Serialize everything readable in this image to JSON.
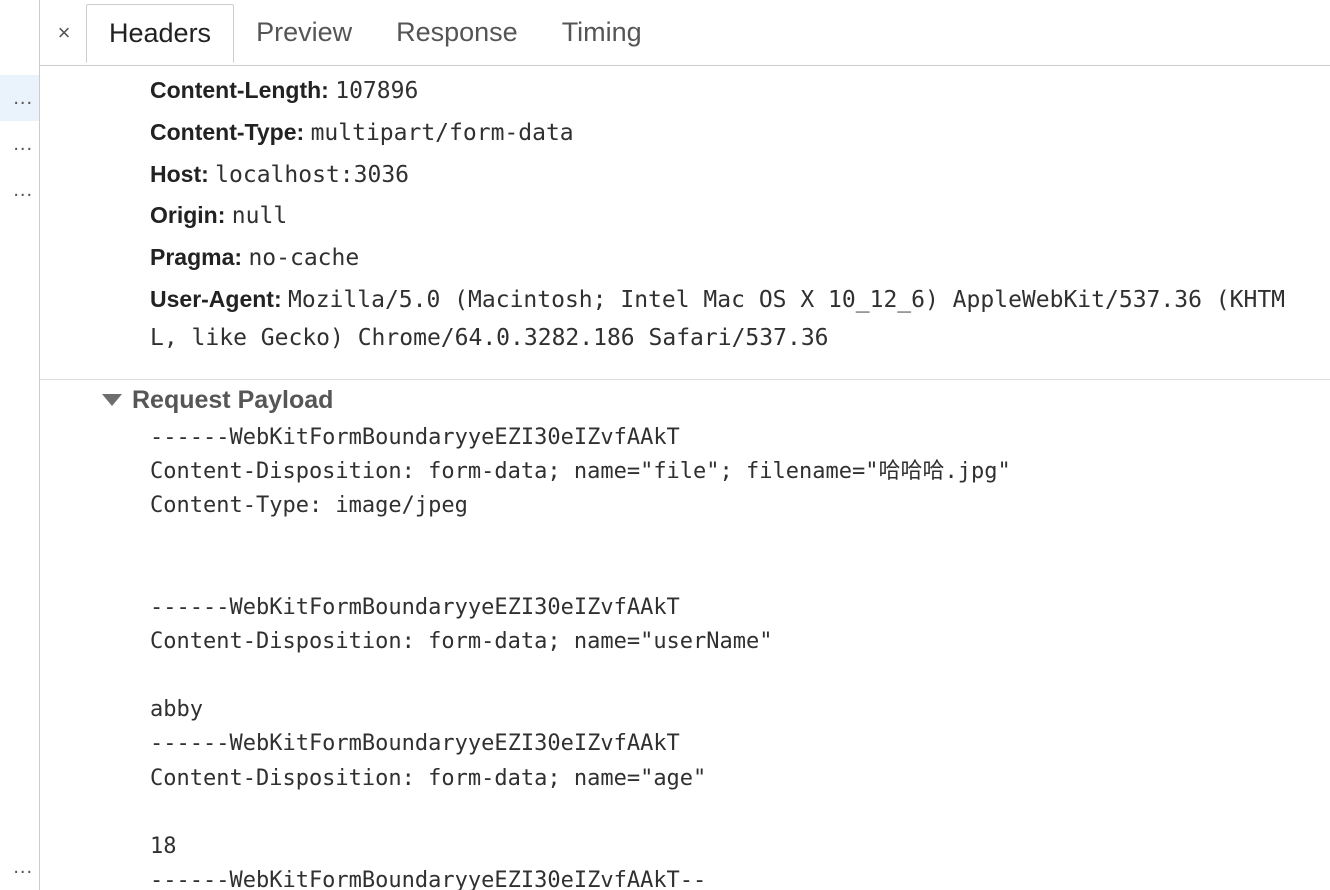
{
  "sidebar": {
    "items": [
      {
        "label": "...",
        "selected": true
      },
      {
        "label": "...",
        "selected": false
      },
      {
        "label": "...",
        "selected": false
      }
    ],
    "bottom": [
      {
        "label": "...",
        "selected": false
      }
    ]
  },
  "tabs": {
    "close_symbol": "×",
    "items": [
      {
        "label": "Headers",
        "active": true
      },
      {
        "label": "Preview",
        "active": false
      },
      {
        "label": "Response",
        "active": false
      },
      {
        "label": "Timing",
        "active": false
      }
    ]
  },
  "headers": [
    {
      "name": "Content-Length:",
      "value": "107896"
    },
    {
      "name": "Content-Type:",
      "value": "multipart/form-data"
    },
    {
      "name": "Host:",
      "value": "localhost:3036"
    },
    {
      "name": "Origin:",
      "value": "null"
    },
    {
      "name": "Pragma:",
      "value": "no-cache"
    },
    {
      "name": "User-Agent:",
      "value": "Mozilla/5.0 (Macintosh; Intel Mac OS X 10_12_6) AppleWebKit/537.36 (KHTML, like Gecko) Chrome/64.0.3282.186 Safari/537.36"
    }
  ],
  "section": {
    "title": "Request Payload"
  },
  "payload": "------WebKitFormBoundaryyeEZI30eIZvfAAkT\nContent-Disposition: form-data; name=\"file\"; filename=\"哈哈哈.jpg\"\nContent-Type: image/jpeg\n\n\n------WebKitFormBoundaryyeEZI30eIZvfAAkT\nContent-Disposition: form-data; name=\"userName\"\n\nabby\n------WebKitFormBoundaryyeEZI30eIZvfAAkT\nContent-Disposition: form-data; name=\"age\"\n\n18\n------WebKitFormBoundaryyeEZI30eIZvfAAkT--"
}
